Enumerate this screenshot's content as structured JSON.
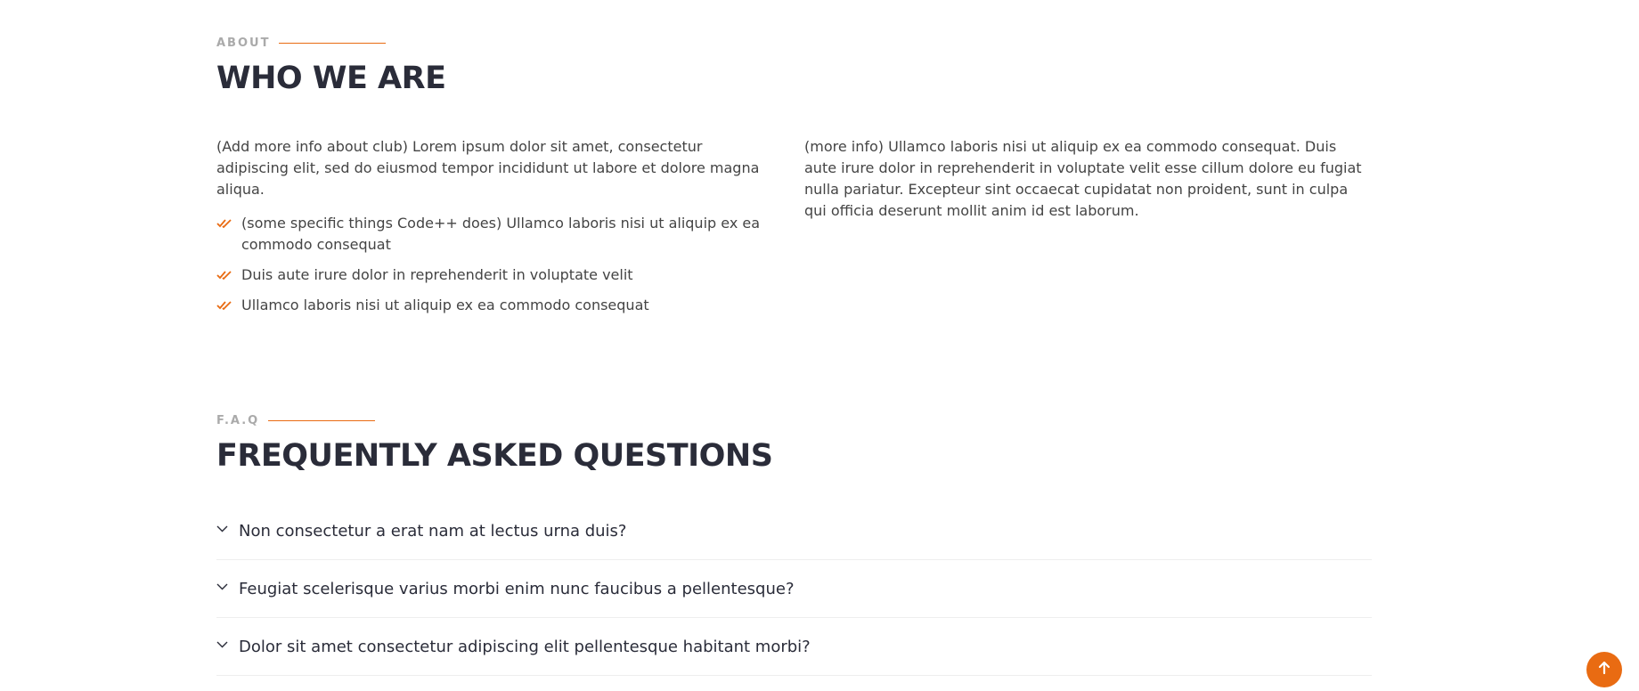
{
  "about": {
    "eyebrow": "ABOUT",
    "title": "WHO WE ARE",
    "intro": "(Add more info about club) Lorem ipsum dolor sit amet, consectetur adipiscing elit, sed do eiusmod tempor incididunt ut labore et dolore magna aliqua.",
    "features": [
      "(some specific things Code++ does) Ullamco laboris nisi ut aliquip ex ea commodo consequat",
      "Duis aute irure dolor in reprehenderit in voluptate velit",
      "Ullamco laboris nisi ut aliquip ex ea commodo consequat"
    ],
    "more_info": "(more info) Ullamco laboris nisi ut aliquip ex ea commodo consequat. Duis aute irure dolor in reprehenderit in voluptate velit esse cillum dolore eu fugiat nulla pariatur. Excepteur sint occaecat cupidatat non proident, sunt in culpa qui officia deserunt mollit anim id est laborum."
  },
  "faq": {
    "eyebrow": "F.A.Q",
    "title": "FREQUENTLY ASKED QUESTIONS",
    "questions": [
      "Non consectetur a erat nam at lectus urna duis?",
      "Feugiat scelerisque varius morbi enim nunc faucibus a pellentesque?",
      "Dolor sit amet consectetur adipiscing elit pellentesque habitant morbi?"
    ]
  },
  "icons": {
    "feature": "double-check-icon",
    "faq_toggle": "chevron-down-icon",
    "back_to_top": "arrow-up-icon"
  },
  "colors": {
    "accent": "#e96b12",
    "heading": "#2a2c39",
    "text": "#444444"
  }
}
